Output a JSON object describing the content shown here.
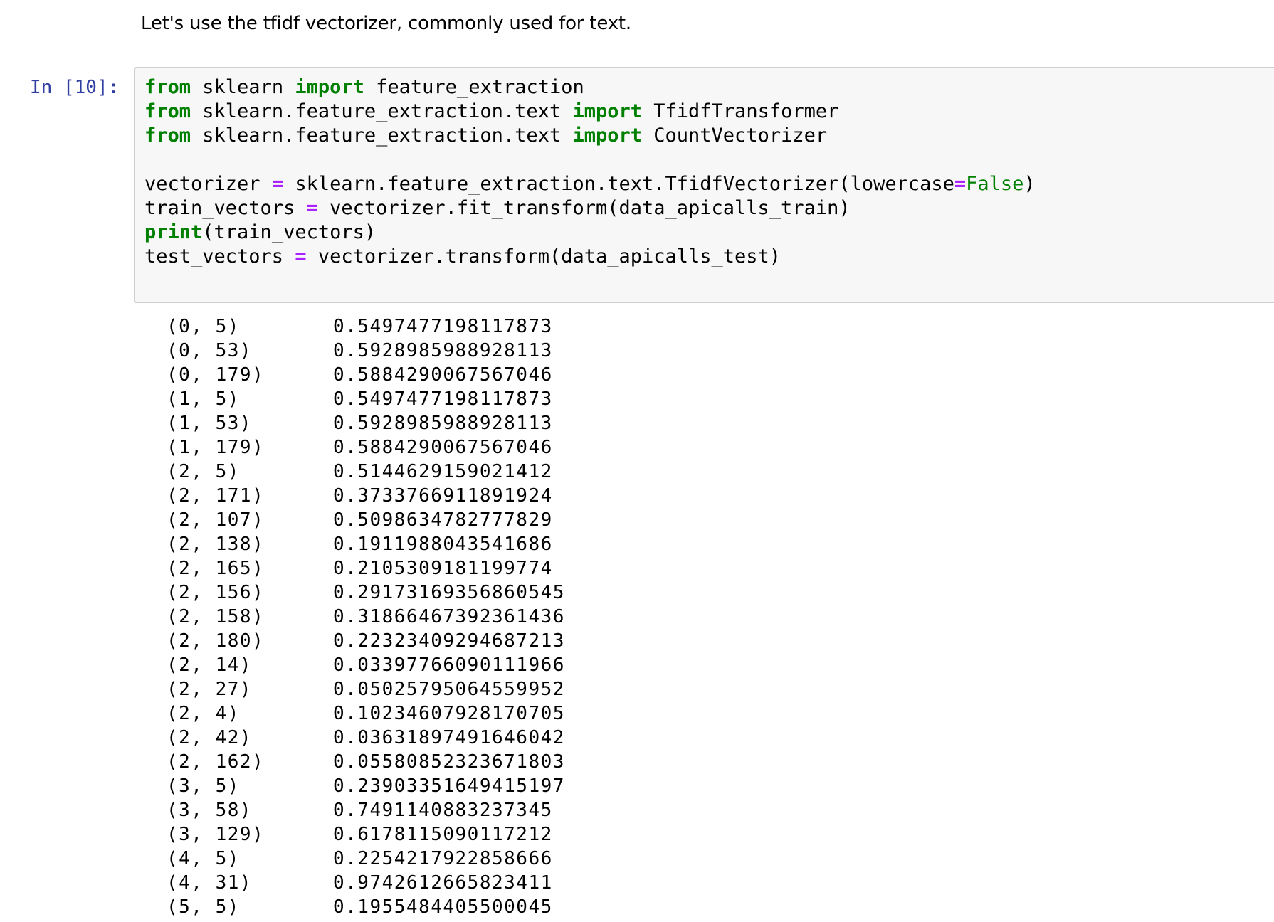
{
  "markdown": {
    "text": "Let's use the tfidf vectorizer, commonly used for text."
  },
  "cell": {
    "prompt": "In [10]:",
    "code": {
      "line1": {
        "k1": "from",
        "t1": " sklearn ",
        "k2": "import",
        "t2": " feature_extraction"
      },
      "line2": {
        "k1": "from",
        "t1": " sklearn.feature_extraction.text ",
        "k2": "import",
        "t2": " TfidfTransformer"
      },
      "line3": {
        "k1": "from",
        "t1": " sklearn.feature_extraction.text ",
        "k2": "import",
        "t2": " CountVectorizer"
      },
      "line5": {
        "t1": "vectorizer ",
        "op": "=",
        "t2": " sklearn.feature_extraction.text.TfidfVectorizer(lowercase",
        "op2": "=",
        "const": "False",
        "t3": ")"
      },
      "line6": {
        "t1": "train_vectors ",
        "op": "=",
        "t2": " vectorizer.fit_transform(data_apicalls_train)"
      },
      "line7": {
        "k1": "print",
        "t1": "(train_vectors)"
      },
      "line8": {
        "t1": "test_vectors ",
        "op": "=",
        "t2": " vectorizer.transform(data_apicalls_test)"
      }
    }
  },
  "output": {
    "rows": [
      {
        "index": "(0, 5)",
        "value": "0.5497477198117873"
      },
      {
        "index": "(0, 53)",
        "value": "0.5928985988928113"
      },
      {
        "index": "(0, 179)",
        "value": "0.5884290067567046"
      },
      {
        "index": "(1, 5)",
        "value": "0.5497477198117873"
      },
      {
        "index": "(1, 53)",
        "value": "0.5928985988928113"
      },
      {
        "index": "(1, 179)",
        "value": "0.5884290067567046"
      },
      {
        "index": "(2, 5)",
        "value": "0.5144629159021412"
      },
      {
        "index": "(2, 171)",
        "value": "0.3733766911891924"
      },
      {
        "index": "(2, 107)",
        "value": "0.5098634782777829"
      },
      {
        "index": "(2, 138)",
        "value": "0.1911988043541686"
      },
      {
        "index": "(2, 165)",
        "value": "0.2105309181199774"
      },
      {
        "index": "(2, 156)",
        "value": "0.29173169356860545"
      },
      {
        "index": "(2, 158)",
        "value": "0.31866467392361436"
      },
      {
        "index": "(2, 180)",
        "value": "0.22323409294687213"
      },
      {
        "index": "(2, 14)",
        "value": "0.03397766090111966"
      },
      {
        "index": "(2, 27)",
        "value": "0.05025795064559952"
      },
      {
        "index": "(2, 4)",
        "value": "0.10234607928170705"
      },
      {
        "index": "(2, 42)",
        "value": "0.03631897491646042"
      },
      {
        "index": "(2, 162)",
        "value": "0.05580852323671803"
      },
      {
        "index": "(3, 5)",
        "value": "0.23903351649415197"
      },
      {
        "index": "(3, 58)",
        "value": "0.7491140883237345"
      },
      {
        "index": "(3, 129)",
        "value": "0.6178115090117212"
      },
      {
        "index": "(4, 5)",
        "value": "0.2254217922858666"
      },
      {
        "index": "(4, 31)",
        "value": "0.9742612665823411"
      },
      {
        "index": "(5, 5)",
        "value": "0.1955484405500045"
      }
    ]
  },
  "colors": {
    "prompt": "#303f9f",
    "keyword": "#008000",
    "operator": "#aa22ff",
    "cell_background": "#f7f7f7",
    "cell_border": "#cfcfcf"
  }
}
